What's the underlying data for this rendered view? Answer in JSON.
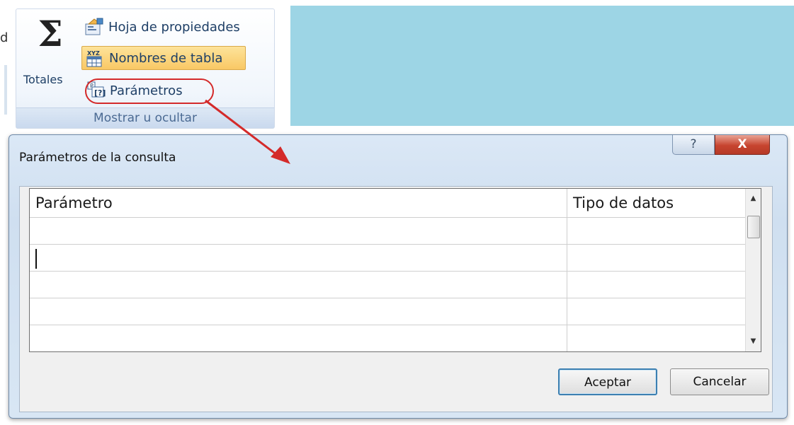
{
  "background": {
    "left_text": "d"
  },
  "ribbon": {
    "totals_label": "Totales",
    "property_sheet_label": "Hoja de propiedades",
    "table_names_label": "Nombres de tabla",
    "parameters_label": "Parámetros",
    "group_caption": "Mostrar u ocultar",
    "icons": [
      "sigma-icon",
      "property-sheet-icon",
      "table-names-icon",
      "parameters-icon"
    ]
  },
  "annotation": {
    "color": "#d42a2a"
  },
  "dialog": {
    "title": "Parámetros de la consulta",
    "help_label": "?",
    "close_label": "X",
    "grid": {
      "columns": [
        "Parámetro",
        "Tipo de datos"
      ],
      "rows": [
        [
          "",
          ""
        ],
        [
          "",
          ""
        ],
        [
          "",
          ""
        ],
        [
          "",
          ""
        ]
      ]
    },
    "ok_label": "Aceptar",
    "cancel_label": "Cancelar"
  },
  "colors": {
    "backdrop": "#9dd5e5",
    "accent": "#3c7fb1",
    "close": "#c7442f",
    "highlight": "#f9c865"
  }
}
